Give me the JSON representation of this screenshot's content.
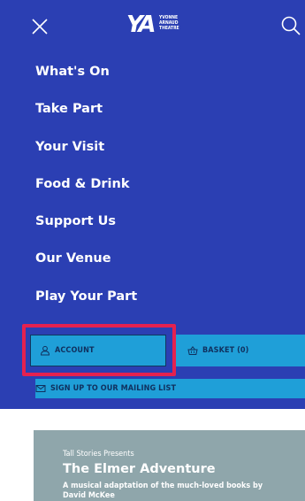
{
  "header": {
    "logo_mark": "YA",
    "logo_lines": [
      "YVONNE",
      "ARNAUD",
      "THEATRE"
    ]
  },
  "nav": {
    "items": [
      {
        "label": "What's On"
      },
      {
        "label": "Take Part"
      },
      {
        "label": "Your Visit"
      },
      {
        "label": "Food & Drink"
      },
      {
        "label": "Support Us"
      },
      {
        "label": "Our Venue"
      },
      {
        "label": "Play Your Part"
      }
    ]
  },
  "actions": {
    "account_label": "ACCOUNT",
    "basket_label": "BASKET (0)",
    "mailing_label": "SIGN UP TO OUR MAILING LIST"
  },
  "card": {
    "presenter": "Tall Stories Presents",
    "title": "The Elmer Adventure",
    "description": "A musical adaptation of the much-loved books by David McKee"
  },
  "colors": {
    "menu_background": "#2b3fb3",
    "button_background": "#1f9fd8",
    "button_text": "#10305e",
    "highlight": "#e5214f",
    "card_background": "#8fa6ab"
  },
  "icons": {
    "close": "close-icon",
    "search": "search-icon",
    "account": "user-icon",
    "basket": "basket-icon",
    "mail": "mail-icon"
  }
}
